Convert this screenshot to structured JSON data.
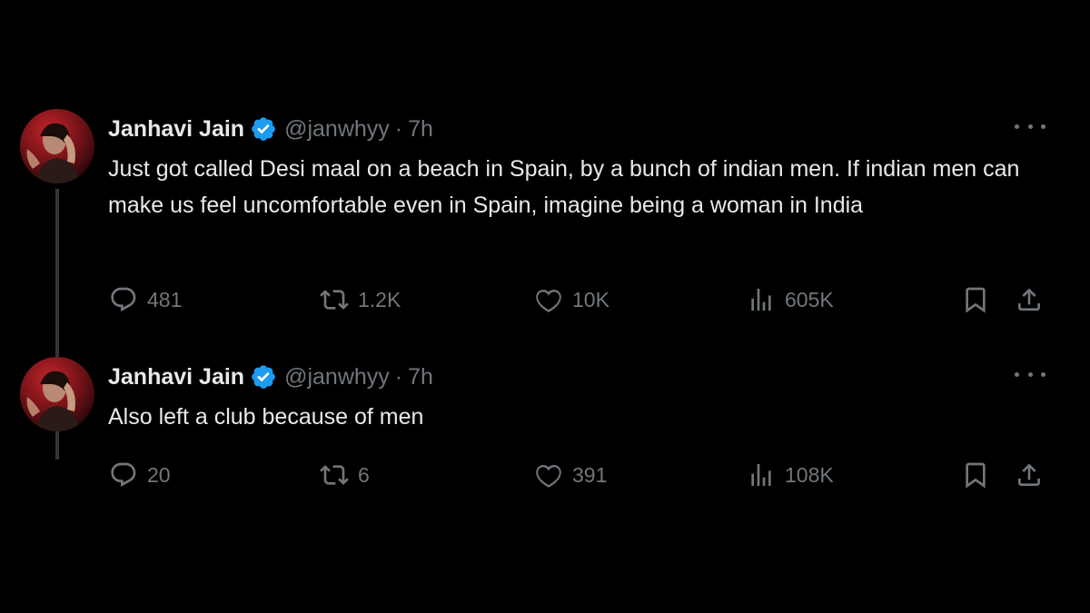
{
  "tweets": [
    {
      "author": {
        "name": "Janhavi Jain",
        "handle": "@janwhyy",
        "separator": "·",
        "time": "7h"
      },
      "text": "Just got called Desi maal on a beach in Spain, by a bunch of indian men. If indian men can make us feel uncomfortable even in Spain, imagine being a woman in India",
      "stats": {
        "replies": "481",
        "reposts": "1.2K",
        "likes": "10K",
        "views": "605K"
      }
    },
    {
      "author": {
        "name": "Janhavi Jain",
        "handle": "@janwhyy",
        "separator": "·",
        "time": "7h"
      },
      "text": "Also left a club because of men",
      "stats": {
        "replies": "20",
        "reposts": "6",
        "likes": "391",
        "views": "108K"
      }
    }
  ],
  "colors": {
    "background": "#000000",
    "text_primary": "#e7e9ea",
    "text_secondary": "#71767b",
    "verified": "#1d9bf0",
    "thread_line": "#333639"
  },
  "icons": [
    "verified-badge-icon",
    "more-icon",
    "reply-icon",
    "repost-icon",
    "like-icon",
    "views-icon",
    "bookmark-icon",
    "share-icon"
  ]
}
